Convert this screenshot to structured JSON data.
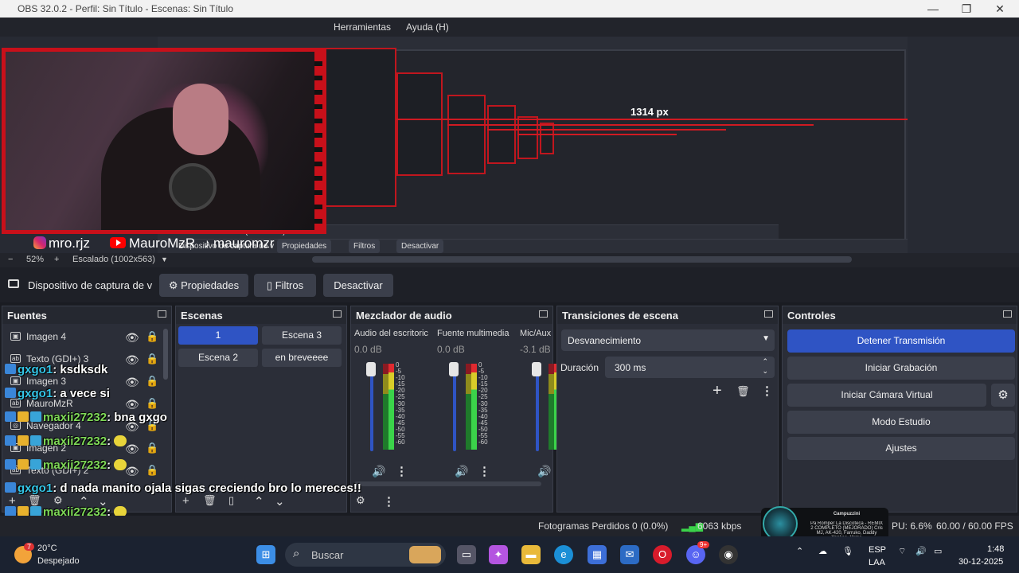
{
  "window": {
    "title": "OBS 32.0.2 - Perfil: Sin Título - Escenas: Sin Título"
  },
  "menu": {
    "tools": "Herramientas",
    "help": "Ayuda (H)"
  },
  "preview": {
    "px_label": "1314 px",
    "nested": {
      "source_name": "Dispositivo de captura de v",
      "properties": "Propiedades",
      "filters": "Filtros",
      "deactivate": "Desactivar",
      "zoom": "52%",
      "scale": "Escalado (1002x563)"
    }
  },
  "socials": {
    "instagram": "mro.rjz",
    "youtube": "MauroMzR",
    "tiktok": "mauromzr"
  },
  "zoom": {
    "minus": "−",
    "value": "52%",
    "plus": "+",
    "scale": "Escalado (1002x563)"
  },
  "source_toolbar": {
    "label": "Dispositivo de captura de v",
    "properties": "Propiedades",
    "filters": "Filtros",
    "deactivate": "Desactivar"
  },
  "sources": {
    "title": "Fuentes",
    "items": [
      {
        "label": "Imagen 4",
        "type": "image"
      },
      {
        "label": "Texto (GDI+) 3",
        "type": "text"
      },
      {
        "label": "Imagen 3",
        "type": "image"
      },
      {
        "label": "MauroMzR",
        "type": "text"
      },
      {
        "label": "Navegador 4",
        "type": "browser"
      },
      {
        "label": "Imagen 2",
        "type": "image"
      },
      {
        "label": "Texto (GDI+) 2",
        "type": "text"
      }
    ]
  },
  "scenes": {
    "title": "Escenas",
    "items": [
      "1",
      "Escena 3",
      "Escena 2",
      "en breveeee"
    ]
  },
  "mixer": {
    "title": "Mezclador de audio",
    "channels": [
      {
        "name": "Audio del escritoric",
        "db": "0.0 dB"
      },
      {
        "name": "Fuente multimedia",
        "db": "0.0 dB"
      },
      {
        "name": "Mic/Aux",
        "db": "-3.1 dB"
      }
    ],
    "scale": [
      "0",
      "-5",
      "-10",
      "-15",
      "-20",
      "-25",
      "-30",
      "-35",
      "-40",
      "-45",
      "-50",
      "-55",
      "-60"
    ]
  },
  "transitions": {
    "title": "Transiciones de escena",
    "selected": "Desvanecimiento",
    "duration_label": "Duración",
    "duration_value": "300 ms"
  },
  "controls": {
    "title": "Controles",
    "stop_stream": "Detener Transmisión",
    "start_record": "Iniciar Grabación",
    "virtual_cam": "Iniciar Cámara Virtual",
    "studio_mode": "Modo Estudio",
    "settings": "Ajustes"
  },
  "status": {
    "dropped": "Fotogramas Perdidos 0 (0.0%)",
    "bitrate": "6063 kbps",
    "cpu": "PU: 6.6%",
    "fps": "60.00 / 60.00 FPS"
  },
  "chat": [
    {
      "user": "gxgo1",
      "msg": "ksdksdk",
      "color": "#34c6e8"
    },
    {
      "user": "gxgo1",
      "msg": "a vece si",
      "color": "#34c6e8"
    },
    {
      "user": "maxii27232",
      "msg": "bna gxgo",
      "color": "#7ed957"
    },
    {
      "user": "maxii27232",
      "msg": "",
      "color": "#7ed957"
    },
    {
      "user": "maxii27232",
      "msg": "",
      "color": "#7ed957"
    },
    {
      "user": "gxgo1",
      "msg": "d nada manito ojala sigas creciendo bro lo mereces!!",
      "color": "#34c6e8"
    },
    {
      "user": "maxii27232",
      "msg": "",
      "color": "#7ed957"
    }
  ],
  "now_playing": {
    "artist": "Campuzzini",
    "track": "Pa Romper La Discoteca - REMIX 2 COMPLETO (MEJORADO) Cris MJ, AK-420, Farruko, Daddy Yankee, Yomo"
  },
  "taskbar": {
    "weather_temp": "20°C",
    "weather_desc": "Despejado",
    "weather_badge": "7",
    "search_placeholder": "Buscar",
    "lang1": "ESP",
    "lang2": "LAA",
    "time": "1:48",
    "date": "30-12-2025",
    "discord_badge": "9+"
  },
  "colors": {
    "accent": "#2f54c4",
    "frame_red": "#c8101a"
  }
}
